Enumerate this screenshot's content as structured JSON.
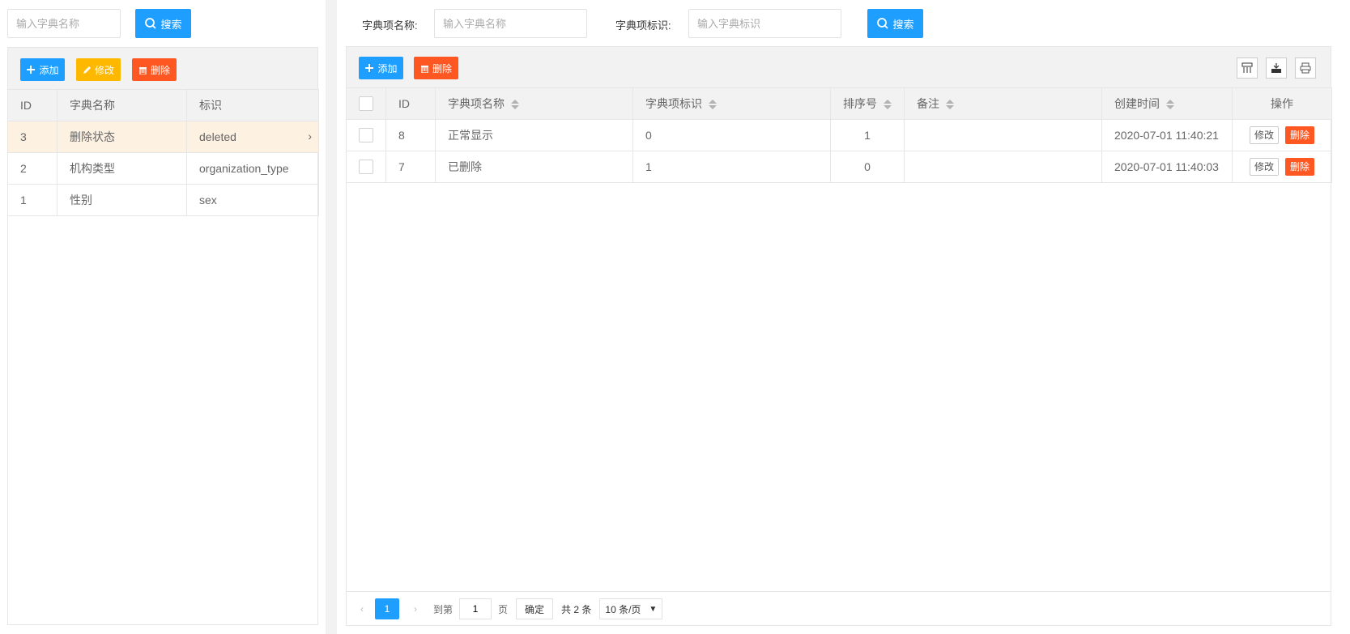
{
  "left": {
    "search_placeholder": "输入字典名称",
    "search_label": "搜索",
    "add_label": "添加",
    "edit_label": "修改",
    "delete_label": "删除",
    "columns": [
      "ID",
      "字典名称",
      "标识"
    ],
    "rows": [
      {
        "id": "3",
        "name": "删除状态",
        "code": "deleted",
        "selected": true
      },
      {
        "id": "2",
        "name": "机构类型",
        "code": "organization_type"
      },
      {
        "id": "1",
        "name": "性别",
        "code": "sex"
      }
    ]
  },
  "right": {
    "name_label": "字典项名称:",
    "name_placeholder": "输入字典名称",
    "code_label": "字典项标识:",
    "code_placeholder": "输入字典标识",
    "search_label": "搜索",
    "add_label": "添加",
    "delete_label": "删除",
    "columns": [
      "ID",
      "字典项名称",
      "字典项标识",
      "排序号",
      "备注",
      "创建时间",
      "操作"
    ],
    "rows": [
      {
        "id": "8",
        "name": "正常显示",
        "code": "0",
        "order": "1",
        "remark": "",
        "created": "2020-07-01 11:40:21"
      },
      {
        "id": "7",
        "name": "已删除",
        "code": "1",
        "order": "0",
        "remark": "",
        "created": "2020-07-01 11:40:03"
      }
    ],
    "row_edit_label": "修改",
    "row_delete_label": "删除",
    "pager": {
      "current_page": "1",
      "goto_label": "到第",
      "goto_value": "1",
      "page_suffix": "页",
      "confirm_label": "确定",
      "total_label": "共 2 条",
      "page_size": "10 条/页"
    }
  },
  "colors": {
    "primary": "#1e9fff",
    "warn": "#ffb800",
    "danger": "#ff5722",
    "selected_row": "#fdf1e2"
  }
}
